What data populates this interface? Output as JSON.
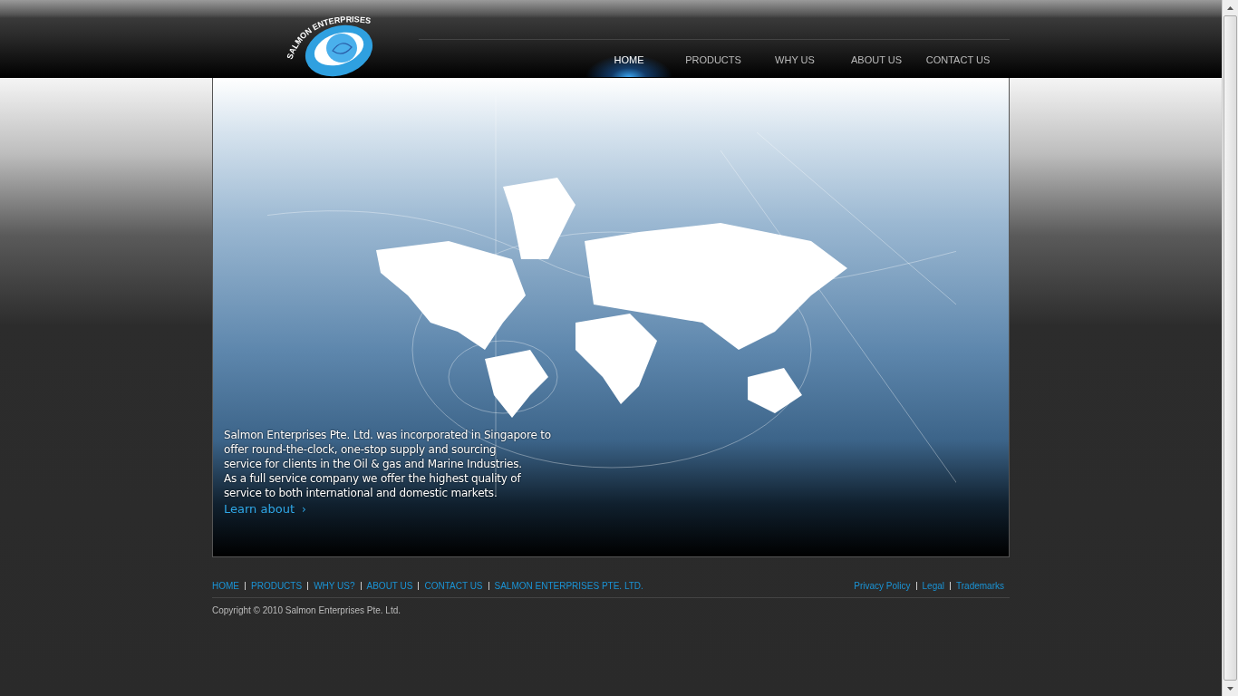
{
  "logo": {
    "text": "SALMON ENTERPRISES"
  },
  "nav": [
    {
      "label": "HOME",
      "selected": true
    },
    {
      "label": "PRODUCTS",
      "selected": false
    },
    {
      "label": "WHY US",
      "selected": false
    },
    {
      "label": "ABOUT US",
      "selected": false
    },
    {
      "label": "CONTACT US",
      "selected": false
    }
  ],
  "hero": {
    "lines": [
      "Salmon Enterprises Pte. Ltd. was incorporated in Singapore to",
      "offer round-the-clock, one-stop supply and sourcing",
      "service for clients in the Oil & gas and Marine Industries.",
      "As a full service company we offer the highest quality of",
      "service to both international and domestic markets."
    ],
    "link": "Learn about",
    "link_arrow": "›"
  },
  "footer": {
    "links": [
      "HOME",
      "PRODUCTS",
      "WHY US?",
      "ABOUT US",
      "CONTACT US",
      "SALMON ENTERPRISES PTE. LTD."
    ],
    "legal": [
      "Privacy Policy",
      "Legal",
      "Trademarks"
    ],
    "copyright": "Copyright © 2010 Salmon Enterprises Pte. Ltd."
  }
}
